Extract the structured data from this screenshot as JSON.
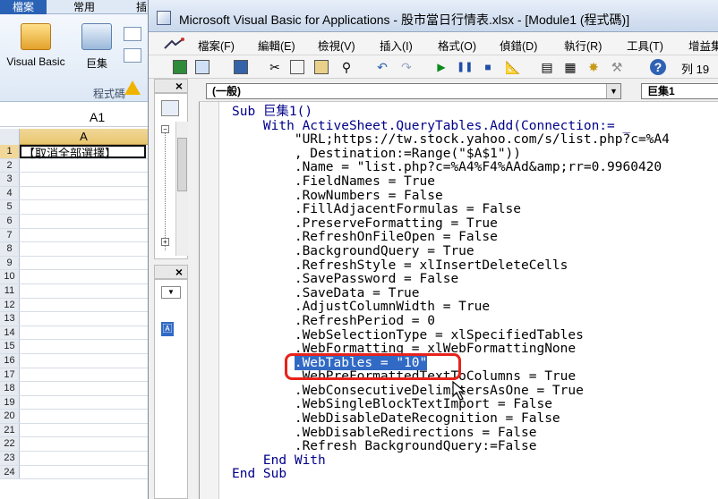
{
  "excel": {
    "tabs": [
      "檔案",
      "常用",
      "插入"
    ],
    "ribbon": {
      "visual_basic_label": "Visual Basic",
      "macro_label": "巨集",
      "group_label": "程式碼"
    },
    "name_box": "A1",
    "column_header": "A",
    "rows": [
      {
        "num": "1",
        "value": "【取消全部選擇】"
      },
      {
        "num": "2",
        "value": ""
      },
      {
        "num": "3",
        "value": ""
      },
      {
        "num": "4",
        "value": ""
      },
      {
        "num": "5",
        "value": ""
      },
      {
        "num": "6",
        "value": ""
      },
      {
        "num": "7",
        "value": ""
      },
      {
        "num": "8",
        "value": ""
      },
      {
        "num": "9",
        "value": ""
      },
      {
        "num": "10",
        "value": ""
      },
      {
        "num": "11",
        "value": ""
      },
      {
        "num": "12",
        "value": ""
      },
      {
        "num": "13",
        "value": ""
      },
      {
        "num": "14",
        "value": ""
      },
      {
        "num": "15",
        "value": ""
      },
      {
        "num": "16",
        "value": ""
      },
      {
        "num": "17",
        "value": ""
      },
      {
        "num": "18",
        "value": ""
      },
      {
        "num": "19",
        "value": ""
      },
      {
        "num": "20",
        "value": ""
      },
      {
        "num": "21",
        "value": ""
      },
      {
        "num": "22",
        "value": ""
      },
      {
        "num": "23",
        "value": ""
      },
      {
        "num": "24",
        "value": ""
      }
    ]
  },
  "vbe": {
    "title": "Microsoft Visual Basic for Applications - 股市當日行情表.xlsx - [Module1 (程式碼)]",
    "menus": [
      "檔案(F)",
      "編輯(E)",
      "檢視(V)",
      "插入(I)",
      "格式(O)",
      "偵錯(D)",
      "執行(R)",
      "工具(T)",
      "增益集"
    ],
    "toolbar_row_label": "列 19",
    "object_combo": "(一般)",
    "proc_combo": "巨集1",
    "code": [
      {
        "indent": 0,
        "text": "Sub 巨集1()"
      },
      {
        "indent": 1,
        "text": "With ActiveSheet.QueryTables.Add(Connection:= _"
      },
      {
        "indent": 2,
        "text": "\"URL;https://tw.stock.yahoo.com/s/list.php?c=%A4"
      },
      {
        "indent": 2,
        "text": ", Destination:=Range(\"$A$1\"))"
      },
      {
        "indent": 2,
        "text": ".Name = \"list.php?c=%A4%F4%AAd&amp;rr=0.9960420"
      },
      {
        "indent": 2,
        "text": ".FieldNames = True"
      },
      {
        "indent": 2,
        "text": ".RowNumbers = False"
      },
      {
        "indent": 2,
        "text": ".FillAdjacentFormulas = False"
      },
      {
        "indent": 2,
        "text": ".PreserveFormatting = True"
      },
      {
        "indent": 2,
        "text": ".RefreshOnFileOpen = False"
      },
      {
        "indent": 2,
        "text": ".BackgroundQuery = True"
      },
      {
        "indent": 2,
        "text": ".RefreshStyle = xlInsertDeleteCells"
      },
      {
        "indent": 2,
        "text": ".SavePassword = False"
      },
      {
        "indent": 2,
        "text": ".SaveData = True"
      },
      {
        "indent": 2,
        "text": ".AdjustColumnWidth = True"
      },
      {
        "indent": 2,
        "text": ".RefreshPeriod = 0"
      },
      {
        "indent": 2,
        "text": ".WebSelectionType = xlSpecifiedTables"
      },
      {
        "indent": 2,
        "text": ".WebFormatting = xlWebFormattingNone"
      },
      {
        "indent": 2,
        "text": ".WebTables = \"10\"",
        "highlight": true
      },
      {
        "indent": 2,
        "text": ".WebPreFormattedTextToColumns = True"
      },
      {
        "indent": 2,
        "text": ".WebConsecutiveDelimitersAsOne = True"
      },
      {
        "indent": 2,
        "text": ".WebSingleBlockTextImport = False"
      },
      {
        "indent": 2,
        "text": ".WebDisableDateRecognition = False"
      },
      {
        "indent": 2,
        "text": ".WebDisableRedirections = False"
      },
      {
        "indent": 2,
        "text": ".Refresh BackgroundQuery:=False"
      },
      {
        "indent": 1,
        "text": "End With"
      },
      {
        "indent": 0,
        "text": "End Sub"
      }
    ]
  },
  "colors": {
    "selection": "#316ac5",
    "annotation_box": "#e8221b",
    "file_tab": "#2a63b5"
  }
}
